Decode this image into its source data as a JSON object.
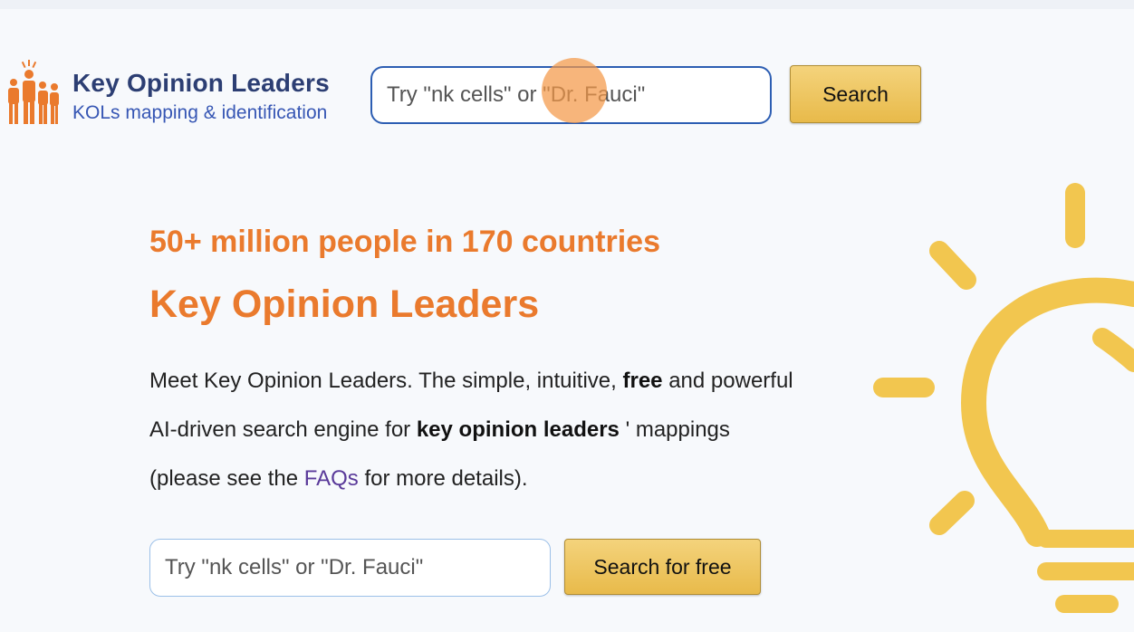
{
  "header": {
    "brand_title": "Key Opinion Leaders",
    "brand_subtitle": "KOLs mapping & identification",
    "search_placeholder": "Try \"nk cells\" or \"Dr. Fauci\"",
    "search_button": "Search"
  },
  "hero": {
    "tagline": "50+ million people in 170 countries",
    "headline": "Key Opinion Leaders",
    "description": {
      "part1": "Meet Key Opinion Leaders. The simple, intuitive, ",
      "bold1": "free",
      "part2": " and powerful AI-driven search engine for ",
      "bold2": "key opinion leaders",
      "part3": " ' mappings (please see the ",
      "link": "FAQs",
      "part4": " for more details)."
    },
    "search_placeholder": "Try \"nk cells\" or \"Dr. Fauci\"",
    "search_button": "Search for free"
  },
  "icons": {
    "logo": "people-group-icon",
    "illustration": "lightbulb-icon"
  },
  "colors": {
    "brand_navy": "#2c3e73",
    "brand_blue": "#3656b4",
    "accent_orange": "#ea7a2d",
    "button_gold": "#e8ba4a",
    "bulb_yellow": "#f2c64f",
    "link_purple": "#5a3a9a"
  }
}
